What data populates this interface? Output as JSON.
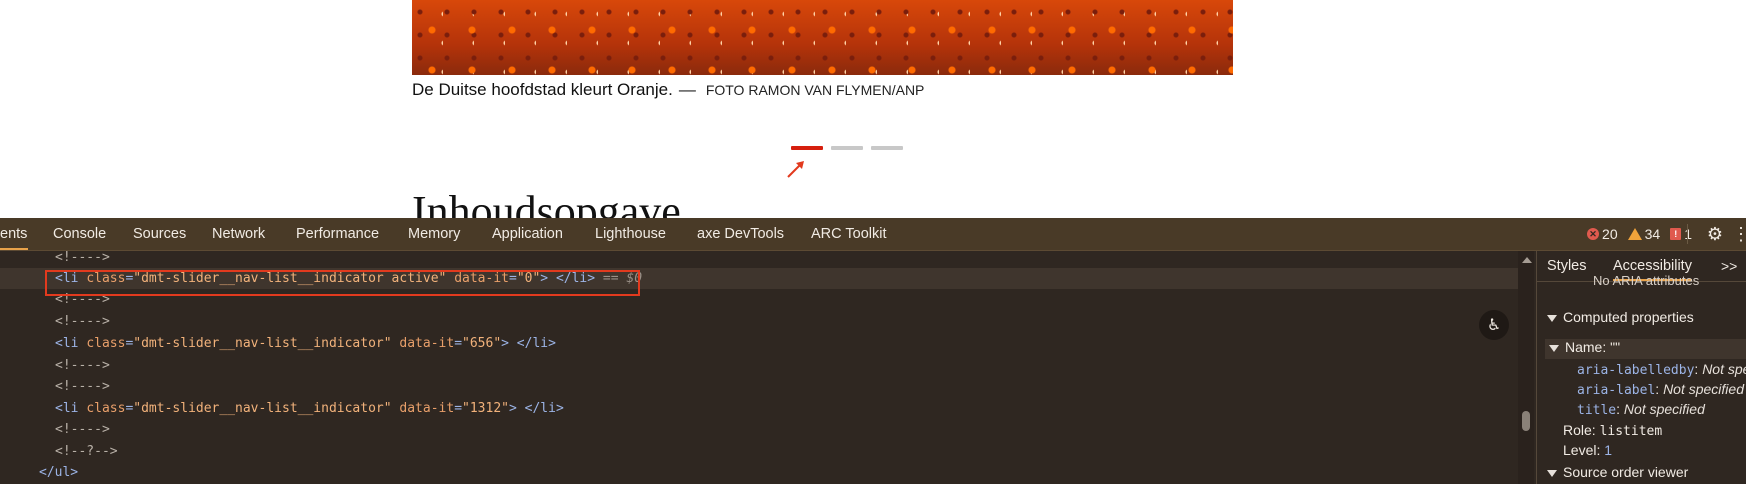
{
  "page": {
    "caption": "De Duitse hoofdstad kleurt Oranje.",
    "caption_dash": "—",
    "photo_credit": "FOTO RAMON VAN FLYMEN/ANP",
    "slider_indicators": [
      {
        "active": true
      },
      {
        "active": false
      },
      {
        "active": false
      }
    ],
    "heading": "Inhoudsopgave"
  },
  "devtools": {
    "tabs": [
      {
        "label": "ents",
        "active": true
      },
      {
        "label": "Console"
      },
      {
        "label": "Sources"
      },
      {
        "label": "Network"
      },
      {
        "label": "Performance"
      },
      {
        "label": "Memory"
      },
      {
        "label": "Application"
      },
      {
        "label": "Lighthouse"
      },
      {
        "label": "axe DevTools"
      },
      {
        "label": "ARC Toolkit"
      }
    ],
    "errors": "20",
    "warnings": "34",
    "issues": "1",
    "dom_lines": [
      {
        "comment": "<!---->"
      },
      {
        "tag_open": "<li",
        "attr": "class",
        "value": "\"dmt-slider__nav-list__indicator active\"",
        "attr2": "data-it",
        "value2": "\"0\"",
        "tag_close": "> </li>",
        "suffix": "== $0",
        "selected": true
      },
      {
        "comment": "<!---->"
      },
      {
        "comment": "<!---->"
      },
      {
        "tag_open": "<li",
        "attr": "class",
        "value": "\"dmt-slider__nav-list__indicator\"",
        "attr2": "data-it",
        "value2": "\"656\"",
        "tag_close": "> </li>"
      },
      {
        "comment": "<!---->"
      },
      {
        "comment": "<!---->"
      },
      {
        "tag_open": "<li",
        "attr": "class",
        "value": "\"dmt-slider__nav-list__indicator\"",
        "attr2": "data-it",
        "value2": "\"1312\"",
        "tag_close": "> </li>"
      },
      {
        "comment": "<!---->"
      },
      {
        "comment": "<!--?-->"
      },
      {
        "tag": "</ul>"
      }
    ],
    "sidebar": {
      "tabs": [
        "Styles",
        "Accessibility"
      ],
      "active_tab": "Accessibility",
      "more": ">>",
      "aria_attrs_note": "No ARIA attributes",
      "computed_properties": "Computed properties",
      "name_label": "Name: \"\"",
      "aria_labelledby_key": "aria-labelledby",
      "aria_labelledby_val": "Not specified",
      "aria_label_key": "aria-label",
      "aria_label_val": "Not specified",
      "title_key": "title",
      "title_val": "Not specified",
      "role_label": "Role:",
      "role_val": "listitem",
      "level_label": "Level:",
      "level_val": "1",
      "source_order": "Source order viewer"
    }
  }
}
